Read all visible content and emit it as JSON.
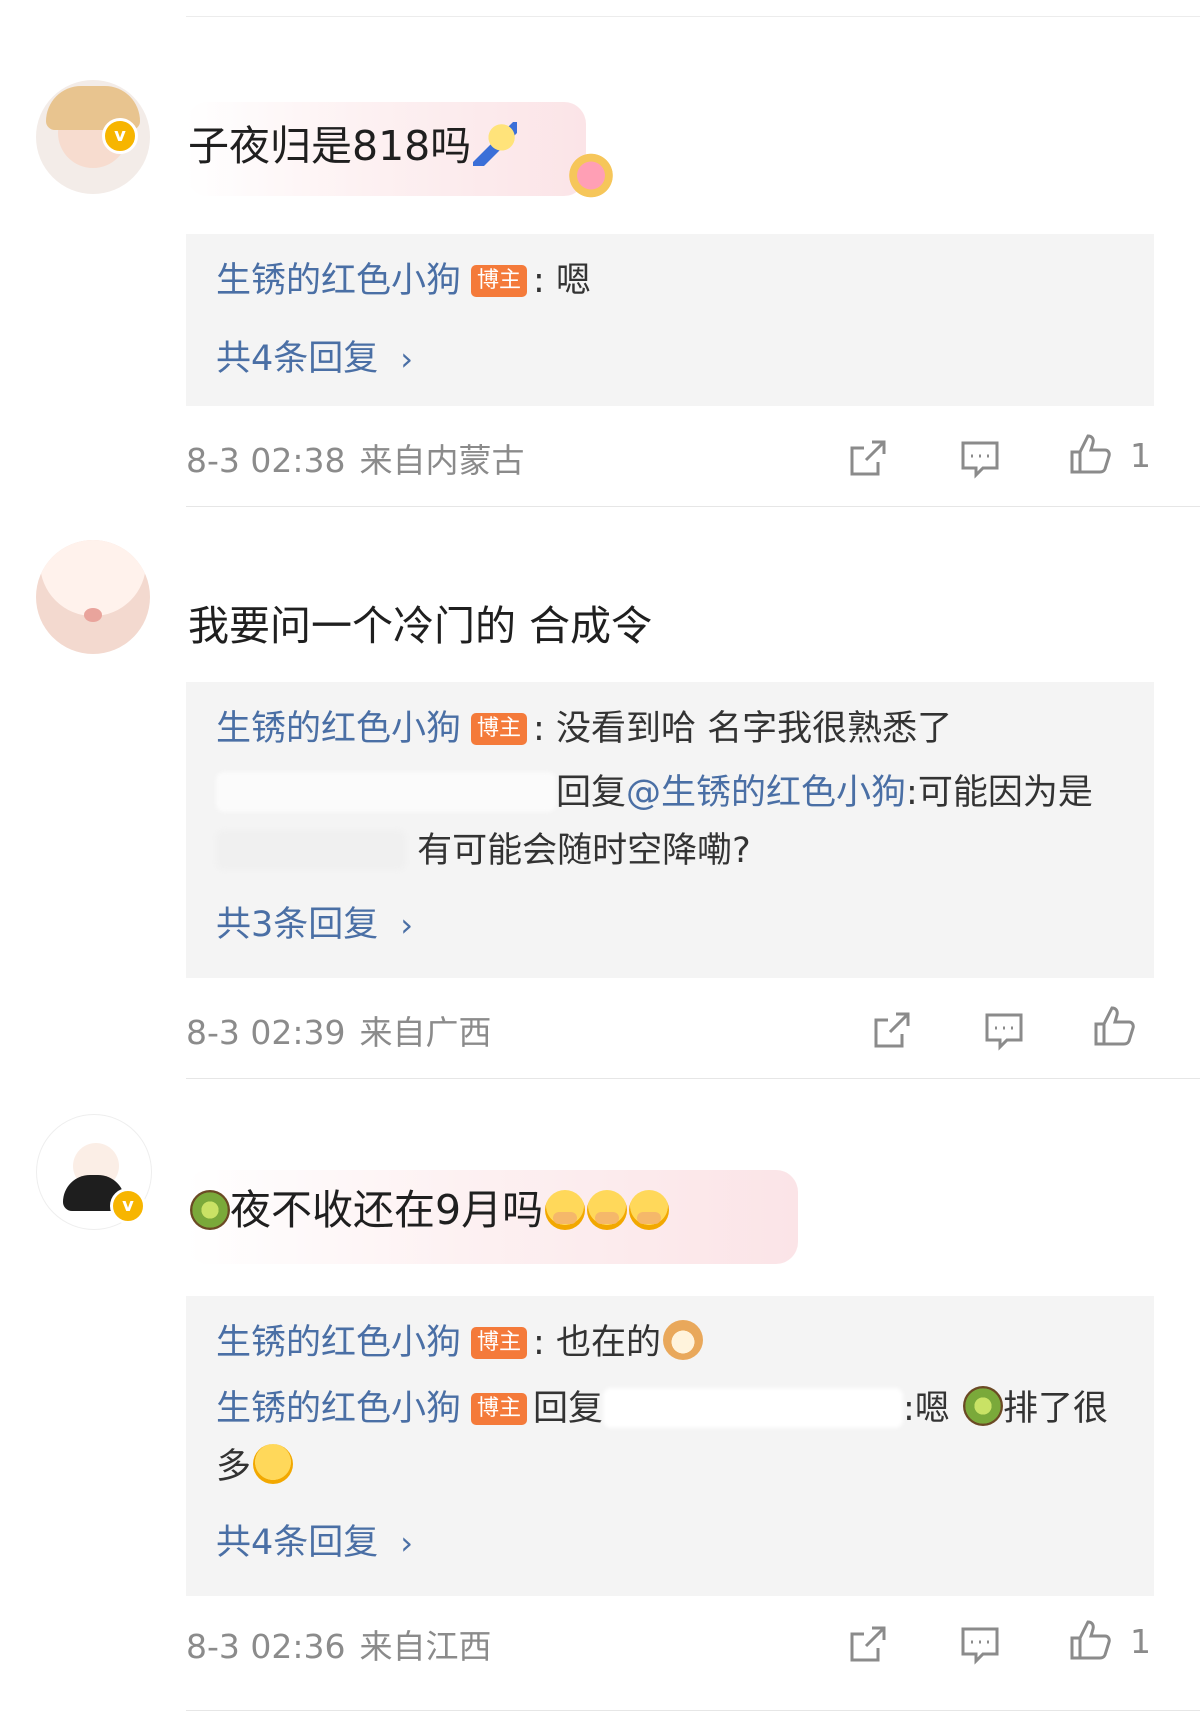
{
  "comments": [
    {
      "text": "子夜归是818吗",
      "replies": [
        {
          "author": "生锈的红色小狗",
          "badge": "博主",
          "sep": ":",
          "content": "嗯"
        }
      ],
      "more": "共4条回复",
      "time": "8-3 02:38",
      "location": "来自内蒙古",
      "likes": "1"
    },
    {
      "text": "我要问一个冷门的 合成令",
      "replies": [
        {
          "author": "生锈的红色小狗",
          "badge": "博主",
          "sep": ":",
          "content": "没看到哈 名字我很熟悉了"
        },
        {
          "prefix": "回复",
          "mention": "@生锈的红色小狗",
          "content": ":可能因为是",
          "continuation": "有可能会随时空降嘞?"
        }
      ],
      "more": "共3条回复",
      "time": "8-3 02:39",
      "location": "来自广西",
      "likes": ""
    },
    {
      "text": "夜不收还在9月吗",
      "replies": [
        {
          "author": "生锈的红色小狗",
          "badge": "博主",
          "sep": ":",
          "content": "也在的"
        },
        {
          "author": "生锈的红色小狗",
          "badge": "博主",
          "prefix": "回复",
          "content": ":嗯",
          "tail": "排了很",
          "continuation": "多"
        }
      ],
      "more": "共4条回复",
      "time": "8-3 02:36",
      "location": "来自江西",
      "likes": "1"
    }
  ],
  "icons": {
    "share": "share-icon",
    "comment": "comment-icon",
    "like": "like-icon",
    "verified": "verified-badge-icon"
  },
  "colors": {
    "author_link": "#4a6fa5",
    "blogger_badge": "#f47a3a",
    "verified_badge": "#f7b500",
    "reply_bg": "#f4f4f4",
    "meta_text": "#8b8b8b"
  }
}
